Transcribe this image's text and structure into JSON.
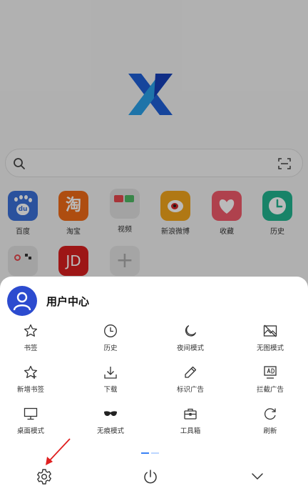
{
  "search": {
    "placeholder": ""
  },
  "shortcuts": [
    {
      "label": "百度",
      "color": "#3a6fd8",
      "glyph": "du"
    },
    {
      "label": "淘宝",
      "color": "#ef6a16",
      "glyph": "淘"
    },
    {
      "label": "视频",
      "color": "#dddddd",
      "glyph": ""
    },
    {
      "label": "新浪微博",
      "color": "#f2a51c",
      "glyph": ""
    },
    {
      "label": "收藏",
      "color": "#f05a6a",
      "glyph": ""
    },
    {
      "label": "历史",
      "color": "#21b48f",
      "glyph": ""
    },
    {
      "label": "",
      "color": "#dddddd",
      "glyph": ""
    },
    {
      "label": "",
      "color": "#d71f1f",
      "glyph": "JD"
    },
    {
      "label": "",
      "color": "#e3e3e3",
      "glyph": "+"
    }
  ],
  "sheet": {
    "user_title": "用户中心",
    "items": [
      {
        "label": "书签",
        "icon": "star-icon"
      },
      {
        "label": "历史",
        "icon": "clock-icon"
      },
      {
        "label": "夜间模式",
        "icon": "moon-icon"
      },
      {
        "label": "无图模式",
        "icon": "no-image-icon"
      },
      {
        "label": "新增书签",
        "icon": "star-plus-icon"
      },
      {
        "label": "下载",
        "icon": "download-icon"
      },
      {
        "label": "标识广告",
        "icon": "pen-icon"
      },
      {
        "label": "拦截广告",
        "icon": "ad-block-icon"
      },
      {
        "label": "桌面模式",
        "icon": "desktop-icon"
      },
      {
        "label": "无痕模式",
        "icon": "mask-icon"
      },
      {
        "label": "工具箱",
        "icon": "toolbox-icon"
      },
      {
        "label": "刷新",
        "icon": "refresh-icon"
      }
    ],
    "bottom": [
      "gear-icon",
      "power-icon",
      "chevron-down-icon"
    ]
  },
  "colors": {
    "accent": "#2c4bcf",
    "arrow": "#e02020"
  }
}
